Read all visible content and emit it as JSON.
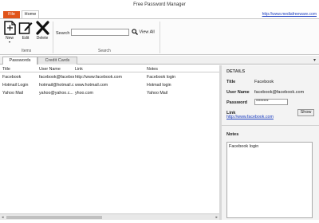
{
  "window": {
    "title": "Free Password Manager"
  },
  "ribbon_tabs": {
    "file": "File",
    "home": "Home"
  },
  "website_link": "http://www.mediafreeware.com",
  "ribbon": {
    "items_group": {
      "label": "Items",
      "new": "New",
      "edit": "Edit",
      "delete": "Delete"
    },
    "search_group": {
      "label": "Search",
      "search_label": "Search",
      "search_value": "",
      "view_all": "View All"
    }
  },
  "doc_tabs": [
    "Passwords",
    "Credit Cards"
  ],
  "table": {
    "columns": [
      "Title",
      "User Name",
      "Link",
      "Notes"
    ],
    "rows": [
      [
        "Facebook",
        "facebook@faceboo...",
        "http://www.facebook.com",
        "Facebook login"
      ],
      [
        "Hotmail Login",
        "hotmail@hotmail.c...",
        "www.hotmail.com",
        "Hotmail login"
      ],
      [
        "Yahoo Mail",
        "yahoo@yahoo.c...",
        "yhoo.com",
        "Yahoo Mail"
      ]
    ]
  },
  "details": {
    "heading": "DETAILS",
    "title_label": "Title",
    "title_value": "Facebook",
    "username_label": "User Name",
    "username_value": "facebook@facebook.com",
    "password_label": "Password",
    "password_value": "********",
    "link_label": "Link",
    "link_value": "http://www.facebook.com",
    "show_button": "Show",
    "notes_heading": "Notes",
    "notes_value": "Facebook login"
  },
  "colors": {
    "file_tab": "#e0541a",
    "link": "#1a3cc0"
  }
}
